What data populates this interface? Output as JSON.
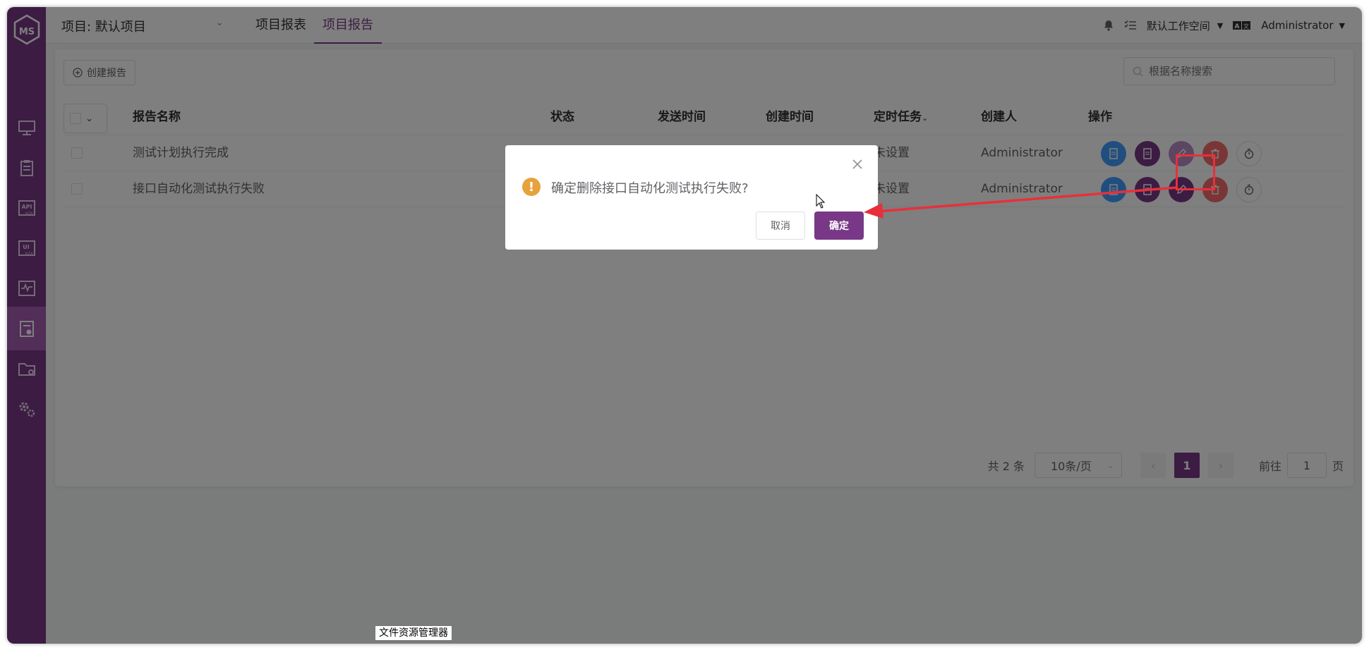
{
  "app": {
    "project_label": "项目: 默认项目",
    "nav_tabs": [
      {
        "label": "项目报表"
      },
      {
        "label": "项目报告"
      }
    ],
    "workspace": "默认工作空间",
    "user": "Administrator"
  },
  "toolbar": {
    "create_label": "创建报告",
    "search_placeholder": "根据名称搜索"
  },
  "table": {
    "columns": {
      "name": "报告名称",
      "status": "状态",
      "send_time": "发送时间",
      "create_time": "创建时间",
      "schedule": "定时任务",
      "creator": "创建人",
      "actions": "操作"
    },
    "rows": [
      {
        "name": "测试计划执行完成",
        "schedule": "未设置",
        "creator": "Administrator"
      },
      {
        "name": "接口自动化测试执行失败",
        "schedule": "未设置",
        "creator": "Administrator"
      }
    ]
  },
  "pagination": {
    "total": "共 2 条",
    "page_size": "10条/页",
    "current": "1",
    "goto_prefix": "前往",
    "goto_value": "1",
    "goto_suffix": "页"
  },
  "dialog": {
    "message": "确定删除接口自动化测试执行失败?",
    "cancel": "取消",
    "confirm": "确定"
  },
  "taskbar_tooltip": "文件资源管理器",
  "colors": {
    "brand": "#783887",
    "blue_action": "#409eff",
    "danger": "#f56c6c",
    "warning": "#e6a23c",
    "annotation_red": "#e8303a"
  }
}
